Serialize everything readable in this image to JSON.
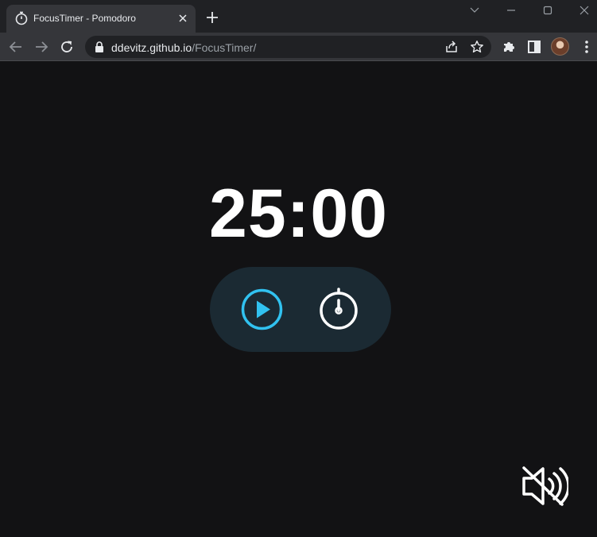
{
  "browser": {
    "tab_title": "FocusTimer - Pomodoro",
    "url_host": "ddevitz.github.io",
    "url_path": "/FocusTimer/"
  },
  "icons": {
    "tab_favicon": "stopwatch-icon",
    "tab_close": "close-icon",
    "new_tab": "plus-icon",
    "back": "arrow-left-icon",
    "forward": "arrow-right-icon",
    "reload": "reload-icon",
    "lock": "lock-icon",
    "share": "share-icon",
    "bookmark": "star-icon",
    "extensions": "puzzle-icon",
    "side_panel": "side-panel-icon",
    "play": "play-icon",
    "stopwatch": "stopwatch-icon",
    "sound": "sound-off-icon"
  },
  "timer": {
    "display": "25:00"
  },
  "colors": {
    "page_background": "#121214",
    "controls_background": "#1b2a33",
    "accent": "#31c2f0",
    "text": "#ffffff"
  }
}
